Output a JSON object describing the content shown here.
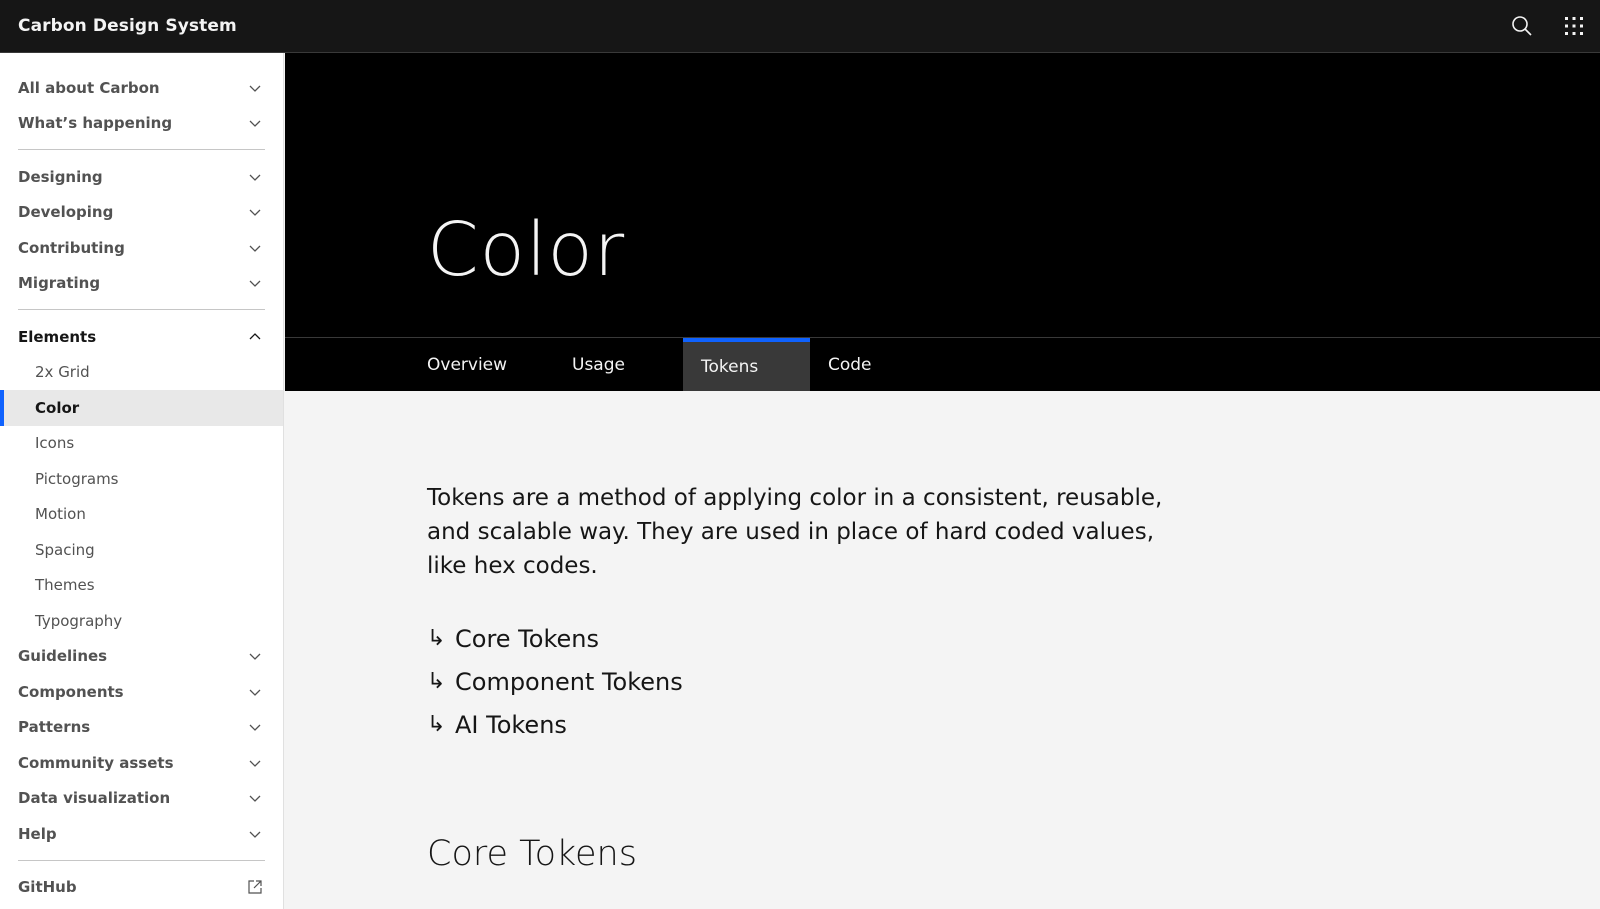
{
  "header": {
    "brand": "Carbon Design System"
  },
  "sidebar": {
    "group1": [
      {
        "label": "All about Carbon"
      },
      {
        "label": "What’s happening"
      }
    ],
    "group2": [
      {
        "label": "Designing"
      },
      {
        "label": "Developing"
      },
      {
        "label": "Contributing"
      },
      {
        "label": "Migrating"
      }
    ],
    "elements": {
      "label": "Elements",
      "children": [
        {
          "label": "2x Grid"
        },
        {
          "label": "Color"
        },
        {
          "label": "Icons"
        },
        {
          "label": "Pictograms"
        },
        {
          "label": "Motion"
        },
        {
          "label": "Spacing"
        },
        {
          "label": "Themes"
        },
        {
          "label": "Typography"
        }
      ]
    },
    "group3": [
      {
        "label": "Guidelines"
      },
      {
        "label": "Components"
      },
      {
        "label": "Patterns"
      },
      {
        "label": "Community assets"
      },
      {
        "label": "Data visualization"
      },
      {
        "label": "Help"
      }
    ],
    "external": {
      "label": "GitHub"
    }
  },
  "hero": {
    "title": "Color"
  },
  "tabs": [
    {
      "label": "Overview"
    },
    {
      "label": "Usage"
    },
    {
      "label": "Tokens"
    },
    {
      "label": "Code"
    }
  ],
  "main": {
    "intro": "Tokens are a method of applying color in a consistent, reusable, and scalable way. They are used in place of hard coded values, like hex codes.",
    "arrow": "↳",
    "links": [
      {
        "label": "Core Tokens"
      },
      {
        "label": "Component Tokens"
      },
      {
        "label": "AI Tokens"
      }
    ],
    "section_title": "Core Tokens"
  },
  "colors": {
    "accent": "#0f62fe",
    "header_bg": "#161616",
    "hero_bg": "#000000",
    "content_bg": "#f4f4f4"
  }
}
